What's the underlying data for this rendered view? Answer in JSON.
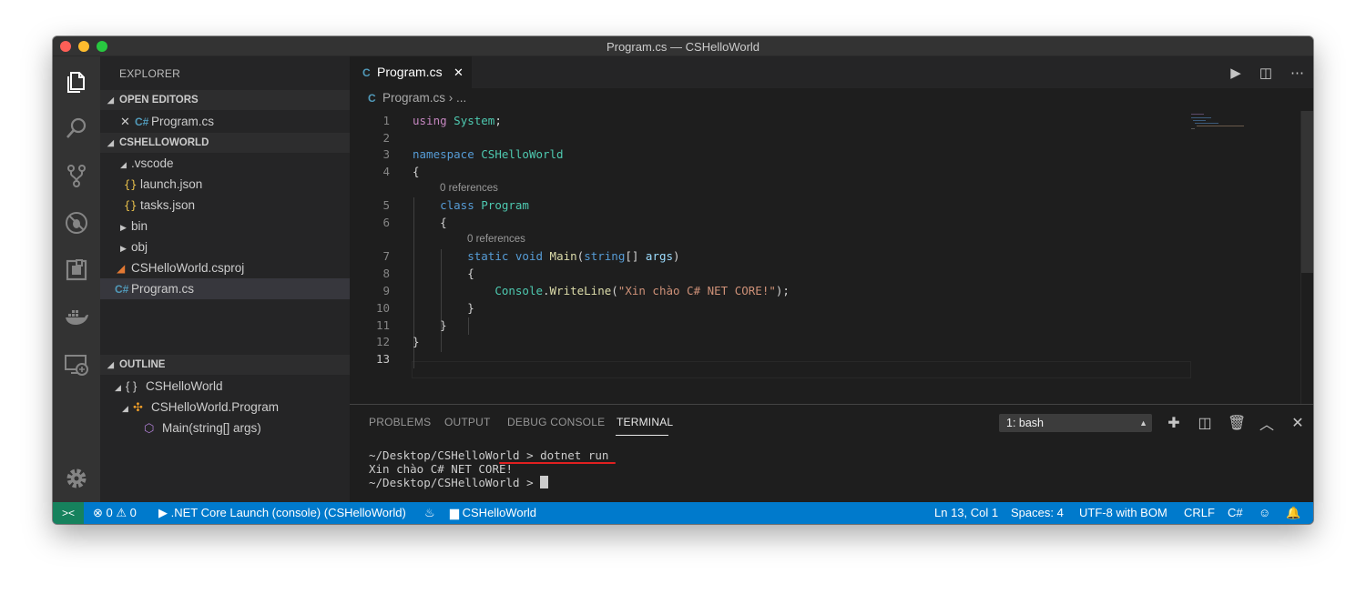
{
  "window": {
    "title": "Program.cs — CSHelloWorld"
  },
  "activity_bar": {
    "icons": [
      "files-icon",
      "search-icon",
      "source-control-icon",
      "debug-icon",
      "extensions-icon",
      "docker-icon",
      "remote-explorer-icon",
      "gear-icon"
    ]
  },
  "sidebar": {
    "title": "EXPLORER",
    "open_editors": {
      "header": "OPEN EDITORS",
      "items": [
        {
          "label": "Program.cs"
        }
      ]
    },
    "project": {
      "header": "CSHELLOWORLD",
      "items": [
        {
          "label": ".vscode"
        },
        {
          "label": "launch.json"
        },
        {
          "label": "tasks.json"
        },
        {
          "label": "bin"
        },
        {
          "label": "obj"
        },
        {
          "label": "CSHelloWorld.csproj"
        },
        {
          "label": "Program.cs"
        }
      ]
    },
    "outline": {
      "header": "OUTLINE",
      "items": [
        {
          "label": "CSHelloWorld"
        },
        {
          "label": "CSHelloWorld.Program"
        },
        {
          "label": "Main(string[] args)"
        }
      ]
    }
  },
  "editor": {
    "tab_label": "Program.cs",
    "breadcrumb": {
      "file": "Program.cs",
      "rest": "..."
    },
    "line_numbers": [
      "1",
      "2",
      "3",
      "4",
      "5",
      "6",
      "7",
      "8",
      "9",
      "10",
      "11",
      "12",
      "13"
    ],
    "codelens": [
      "0 references",
      "0 references"
    ],
    "code": {
      "l1_kw": "using",
      "l1_ty": "System",
      "l1_end": ";",
      "l3_kw": "namespace",
      "l3_ty": "CSHelloWorld",
      "l4": "{",
      "l5_kw": "class",
      "l5_ty": "Program",
      "l6": "{",
      "l7_kw1": "static",
      "l7_kw2": "void",
      "l7_fn": "Main",
      "l7_p1": "(",
      "l7_kw3": "string",
      "l7_p2": "[] ",
      "l7_var": "args",
      "l7_p3": ")",
      "l8": "{",
      "l9_ty": "Console",
      "l9_dot": ".",
      "l9_fn": "WriteLine",
      "l9_p1": "(",
      "l9_str": "\"Xin chào C# NET CORE!\"",
      "l9_p2": ");",
      "l10": "}",
      "l11": "}",
      "l12": "}"
    }
  },
  "panel": {
    "tabs": [
      "PROBLEMS",
      "OUTPUT",
      "DEBUG CONSOLE",
      "TERMINAL"
    ],
    "active_tab": "TERMINAL",
    "terminal_select": "1: bash",
    "terminal_lines": [
      "~/Desktop/CSHelloWorld > dotnet run",
      "Xin chào C# NET CORE!",
      "~/Desktop/CSHelloWorld > "
    ]
  },
  "statusbar": {
    "errors": "0",
    "warnings": "0",
    "launch_config": ".NET Core Launch (console) (CSHelloWorld)",
    "folder": "CSHelloWorld",
    "position": "Ln 13, Col 1",
    "spaces": "Spaces: 4",
    "encoding": "UTF-8 with BOM",
    "eol": "CRLF",
    "language": "C#"
  },
  "colors": {
    "status_bar": "#007acc",
    "remote": "#16825d",
    "underline": "#e02020"
  }
}
